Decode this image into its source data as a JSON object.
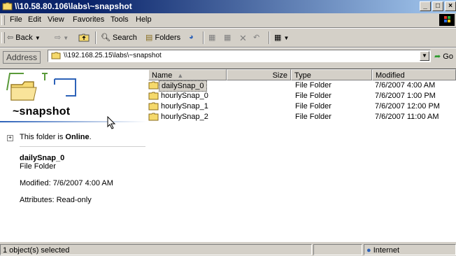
{
  "window": {
    "title": "\\\\10.58.80.106\\labs\\~snapshot"
  },
  "menu": {
    "items": [
      "File",
      "Edit",
      "View",
      "Favorites",
      "Tools",
      "Help"
    ]
  },
  "toolbar": {
    "back_label": "Back",
    "search_label": "Search",
    "folders_label": "Folders"
  },
  "address": {
    "label": "Address",
    "value": "\\\\192.168.25.15\\labs\\~snapshot",
    "go_label": "Go"
  },
  "leftpane": {
    "folder_title": "~snapshot",
    "online_prefix": "This folder is ",
    "online_status": "Online",
    "online_suffix": ".",
    "selected_name": "dailySnap_0",
    "selected_type": "File Folder",
    "modified": "Modified: 7/6/2007 4:00 AM",
    "attributes": "Attributes: Read-only"
  },
  "columns": {
    "name": "Name",
    "size": "Size",
    "type": "Type",
    "modified": "Modified"
  },
  "files": [
    {
      "name": "dailySnap_0",
      "type": "File Folder",
      "modified": "7/6/2007 4:00 AM"
    },
    {
      "name": "hourlySnap_0",
      "type": "File Folder",
      "modified": "7/6/2007 1:00 PM"
    },
    {
      "name": "hourlySnap_1",
      "type": "File Folder",
      "modified": "7/6/2007 12:00 PM"
    },
    {
      "name": "hourlySnap_2",
      "type": "File Folder",
      "modified": "7/6/2007 11:00 AM"
    }
  ],
  "status": {
    "selection": "1 object(s) selected",
    "zone": "Internet"
  }
}
